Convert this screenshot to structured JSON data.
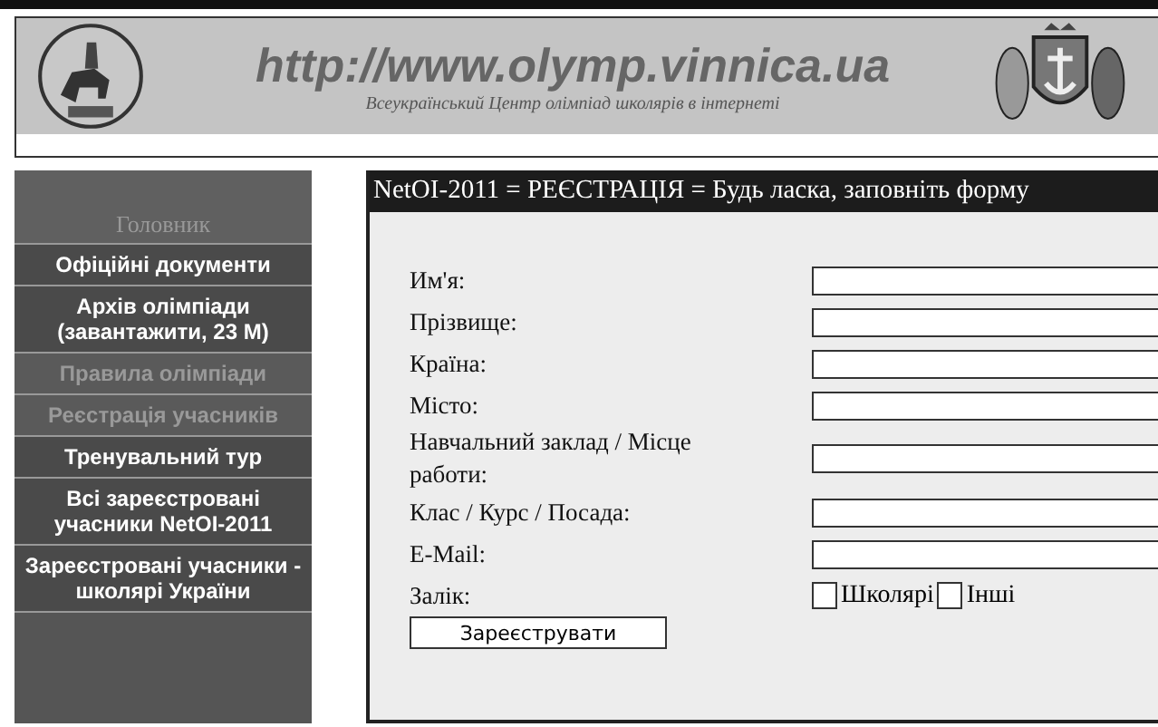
{
  "header": {
    "title": "http://www.olymp.vinnica.ua",
    "subtitle": "Всеукраїнський Центр олімпіад школярів в інтернеті"
  },
  "sidebar": {
    "heading": "Головник",
    "items": [
      {
        "label": "Офіційні документи",
        "disabled": false
      },
      {
        "label": "Архів олімпіади (завантажити, 23 М)",
        "disabled": false
      },
      {
        "label": "Правила олімпіади",
        "disabled": true
      },
      {
        "label": "Реєстрація учасників",
        "disabled": true
      },
      {
        "label": "Тренувальний тур",
        "disabled": false
      },
      {
        "label": "Всі зареєстровані учасники NetOI-2011",
        "disabled": false
      },
      {
        "label": "Зареєстровані учасники - школярі України",
        "disabled": false
      }
    ]
  },
  "form": {
    "title": "NetOI-2011 = РЕЄСТРАЦІЯ = Будь ласка, заповніть форму",
    "fields": [
      {
        "label": "Им'я:"
      },
      {
        "label": "Прізвище:"
      },
      {
        "label": "Країна:"
      },
      {
        "label": "Місто:"
      },
      {
        "label": "Навчальний заклад / Місце работи:"
      },
      {
        "label": "Клас / Курс / Посада:"
      },
      {
        "label": "E-Mail:"
      }
    ],
    "group": {
      "label": "Залік:",
      "options": [
        {
          "label": "Школярі",
          "selected": false
        },
        {
          "label": "Інші",
          "selected": false
        }
      ]
    },
    "submit": "Зареєструвати"
  }
}
